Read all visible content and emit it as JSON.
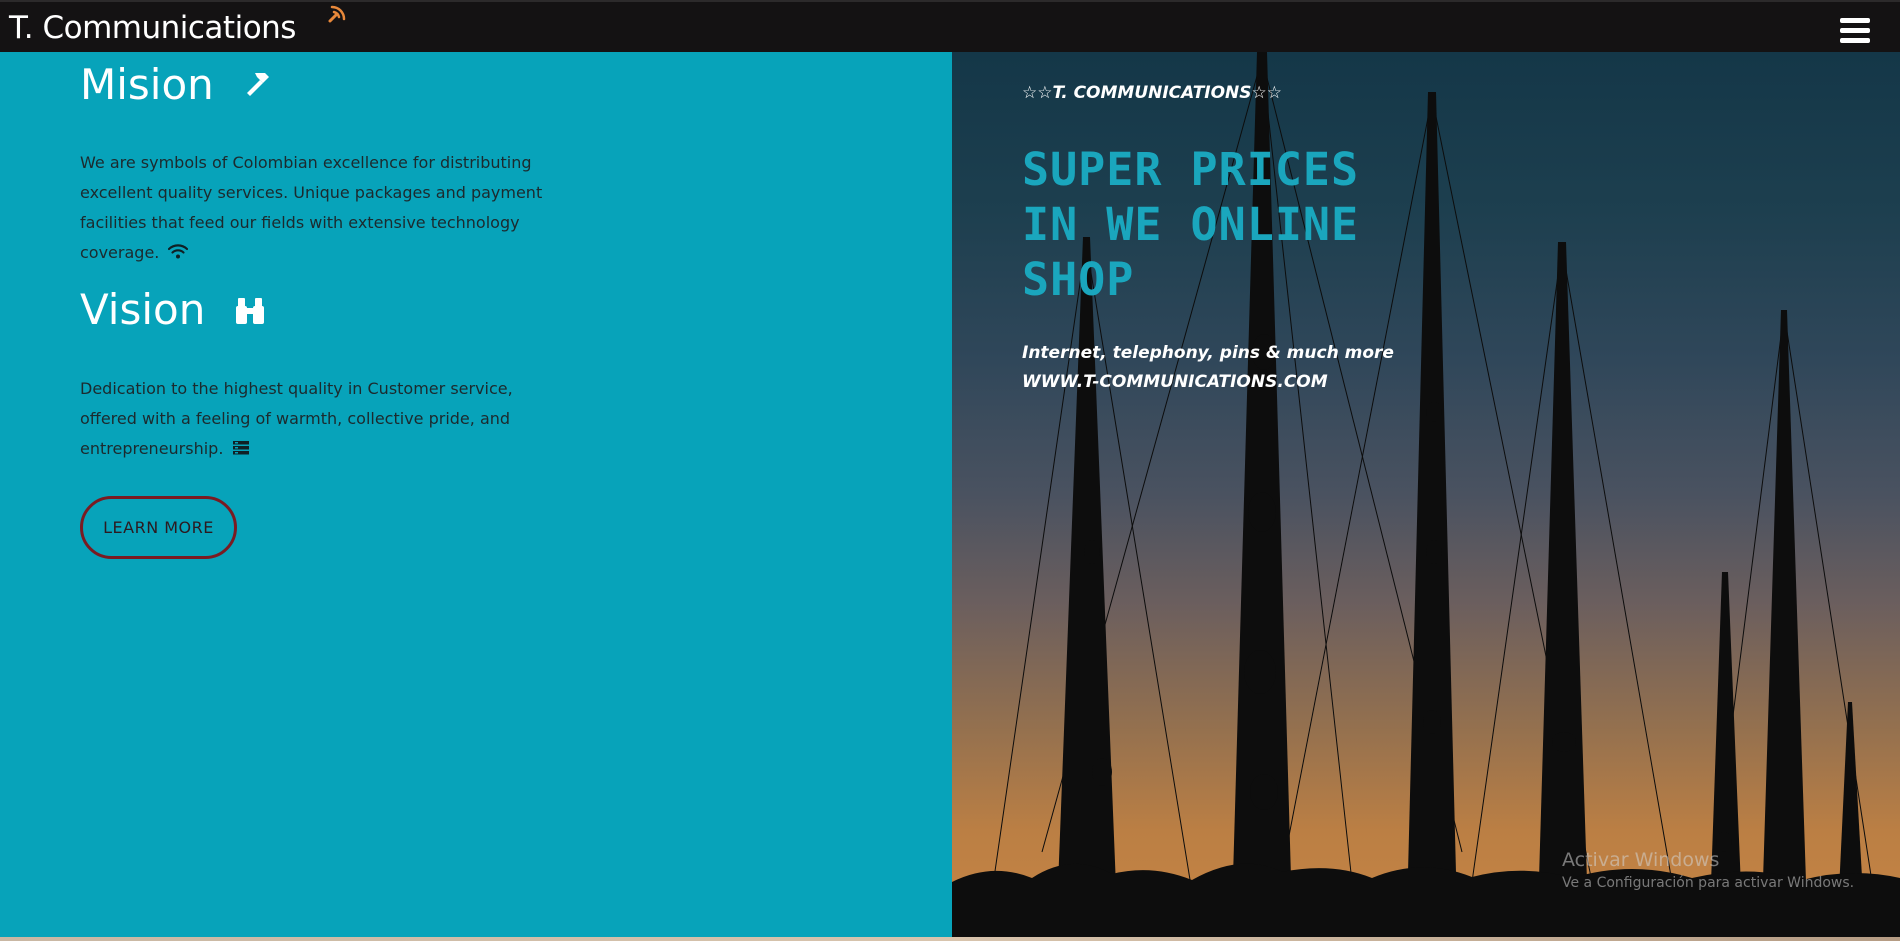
{
  "header": {
    "brand": "T. Communications",
    "brand_icon": "satellite-dish-icon",
    "menu_icon": "hamburger-menu-icon"
  },
  "mission": {
    "title": "Mision",
    "icon": "hammer-icon",
    "text": "We are symbols of Colombian excellence for distributing excellent quality services. Unique packages and payment facilities that feed our fields with extensive technology coverage.",
    "text_icon": "wifi-icon"
  },
  "vision": {
    "title": "Vision",
    "icon": "binoculars-icon",
    "text": "Dedication to the highest quality in Customer service, offered with a feeling of warmth, collective pride, and entrepreneurship.",
    "text_icon": "server-icon"
  },
  "cta": {
    "label": "LEARN MORE"
  },
  "promo": {
    "tagline": "☆☆T. COMMUNICATIONS☆☆",
    "title": "SUPER PRICES IN WE ONLINE SHOP",
    "line1": "Internet, telephony, pins & much more",
    "line2": "WWW.T-COMMUNICATIONS.COM"
  },
  "watermark": {
    "title": "Activar Windows",
    "subtitle": "Ve a Configuración para activar Windows."
  },
  "colors": {
    "navbar": "#141213",
    "left_panel": "#07a3ba",
    "promo_title": "#1aa6bd",
    "button_border": "#7a1b22",
    "brand_icon": "#e8883a"
  }
}
